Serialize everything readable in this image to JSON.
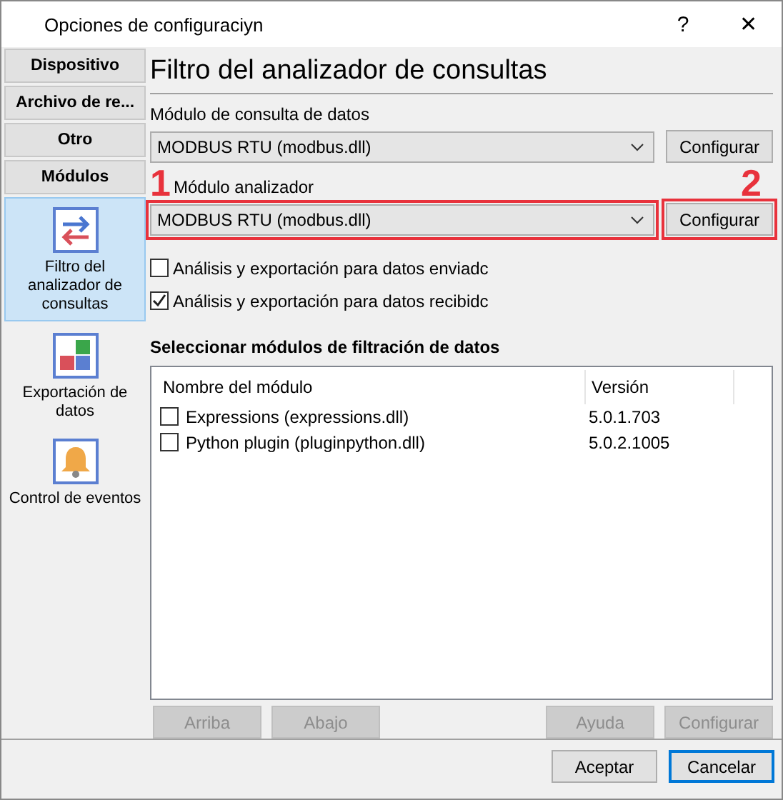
{
  "window": {
    "title": "Opciones de configuraciyn",
    "help": "?",
    "close": "✕"
  },
  "sidebar": {
    "categories": [
      {
        "label": "Dispositivo"
      },
      {
        "label": "Archivo de re..."
      },
      {
        "label": "Otro"
      },
      {
        "label": "Módulos"
      }
    ],
    "items": [
      {
        "label": "Filtro del analizador de consultas",
        "kind": "arrows",
        "selected": true
      },
      {
        "label": "Exportación de datos",
        "kind": "blocks",
        "selected": false
      },
      {
        "label": "Control de eventos",
        "kind": "bell",
        "selected": false
      }
    ]
  },
  "heading": "Filtro del analizador de consultas",
  "module_rows": [
    {
      "label": "Módulo de consulta de datos",
      "value": "MODBUS RTU (modbus.dll)",
      "button": "Configurar",
      "highlighted": false
    },
    {
      "label": "Módulo analizador",
      "value": "MODBUS RTU (modbus.dll)",
      "button": "Configurar",
      "highlighted": true,
      "dropdown_marker": "1",
      "button_marker": "2"
    }
  ],
  "checkboxes": [
    {
      "label": "Análisis y exportación para datos enviadc",
      "checked": false
    },
    {
      "label": "Análisis y exportación para datos recibidc",
      "checked": true
    }
  ],
  "filter_section": {
    "title": "Seleccionar módulos de filtración de datos",
    "columns": [
      "Nombre del módulo",
      "Versión"
    ],
    "rows": [
      {
        "name": "Expressions (expressions.dll)",
        "version": "5.0.1.703",
        "checked": false
      },
      {
        "name": "Python plugin (pluginpython.dll)",
        "version": "5.0.2.1005",
        "checked": false
      }
    ],
    "buttons": [
      {
        "label": "Arriba",
        "disabled": true
      },
      {
        "label": "Abajo",
        "disabled": true
      },
      {
        "label": "Ayuda",
        "disabled": true
      },
      {
        "label": "Configurar",
        "disabled": true
      }
    ]
  },
  "footer_buttons": [
    {
      "label": "Aceptar",
      "default": false
    },
    {
      "label": "Cancelar",
      "default": true
    }
  ]
}
